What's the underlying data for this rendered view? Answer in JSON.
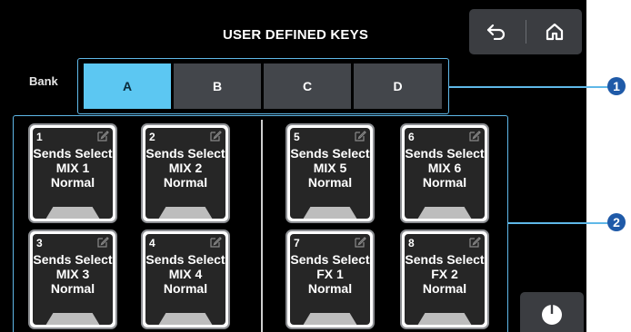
{
  "header": {
    "title": "USER DEFINED KEYS"
  },
  "nav": {
    "back_icon": "undo-arrow-icon",
    "home_icon": "home-icon"
  },
  "bank": {
    "label": "Bank",
    "active": "A",
    "buttons": [
      "A",
      "B",
      "C",
      "D"
    ],
    "active_color": "#5cc7f2"
  },
  "keys": [
    {
      "number": "1",
      "line1": "Sends Select",
      "line2": "MIX 1",
      "line3": "Normal"
    },
    {
      "number": "2",
      "line1": "Sends Select",
      "line2": "MIX 2",
      "line3": "Normal"
    },
    {
      "number": "3",
      "line1": "Sends Select",
      "line2": "MIX 3",
      "line3": "Normal"
    },
    {
      "number": "4",
      "line1": "Sends Select",
      "line2": "MIX 4",
      "line3": "Normal"
    },
    {
      "number": "5",
      "line1": "Sends Select",
      "line2": "MIX 5",
      "line3": "Normal"
    },
    {
      "number": "6",
      "line1": "Sends Select",
      "line2": "MIX 6",
      "line3": "Normal"
    },
    {
      "number": "7",
      "line1": "Sends Select",
      "line2": "FX 1",
      "line3": "Normal"
    },
    {
      "number": "8",
      "line1": "Sends Select",
      "line2": "FX 2",
      "line3": "Normal"
    }
  ],
  "key_edit_icon": "edit-pencil-icon",
  "power_icon": "power-knob-icon",
  "callouts": [
    "1",
    "2"
  ],
  "colors": {
    "callout": "#1f5aa8",
    "frame": "#5fb8e8"
  }
}
